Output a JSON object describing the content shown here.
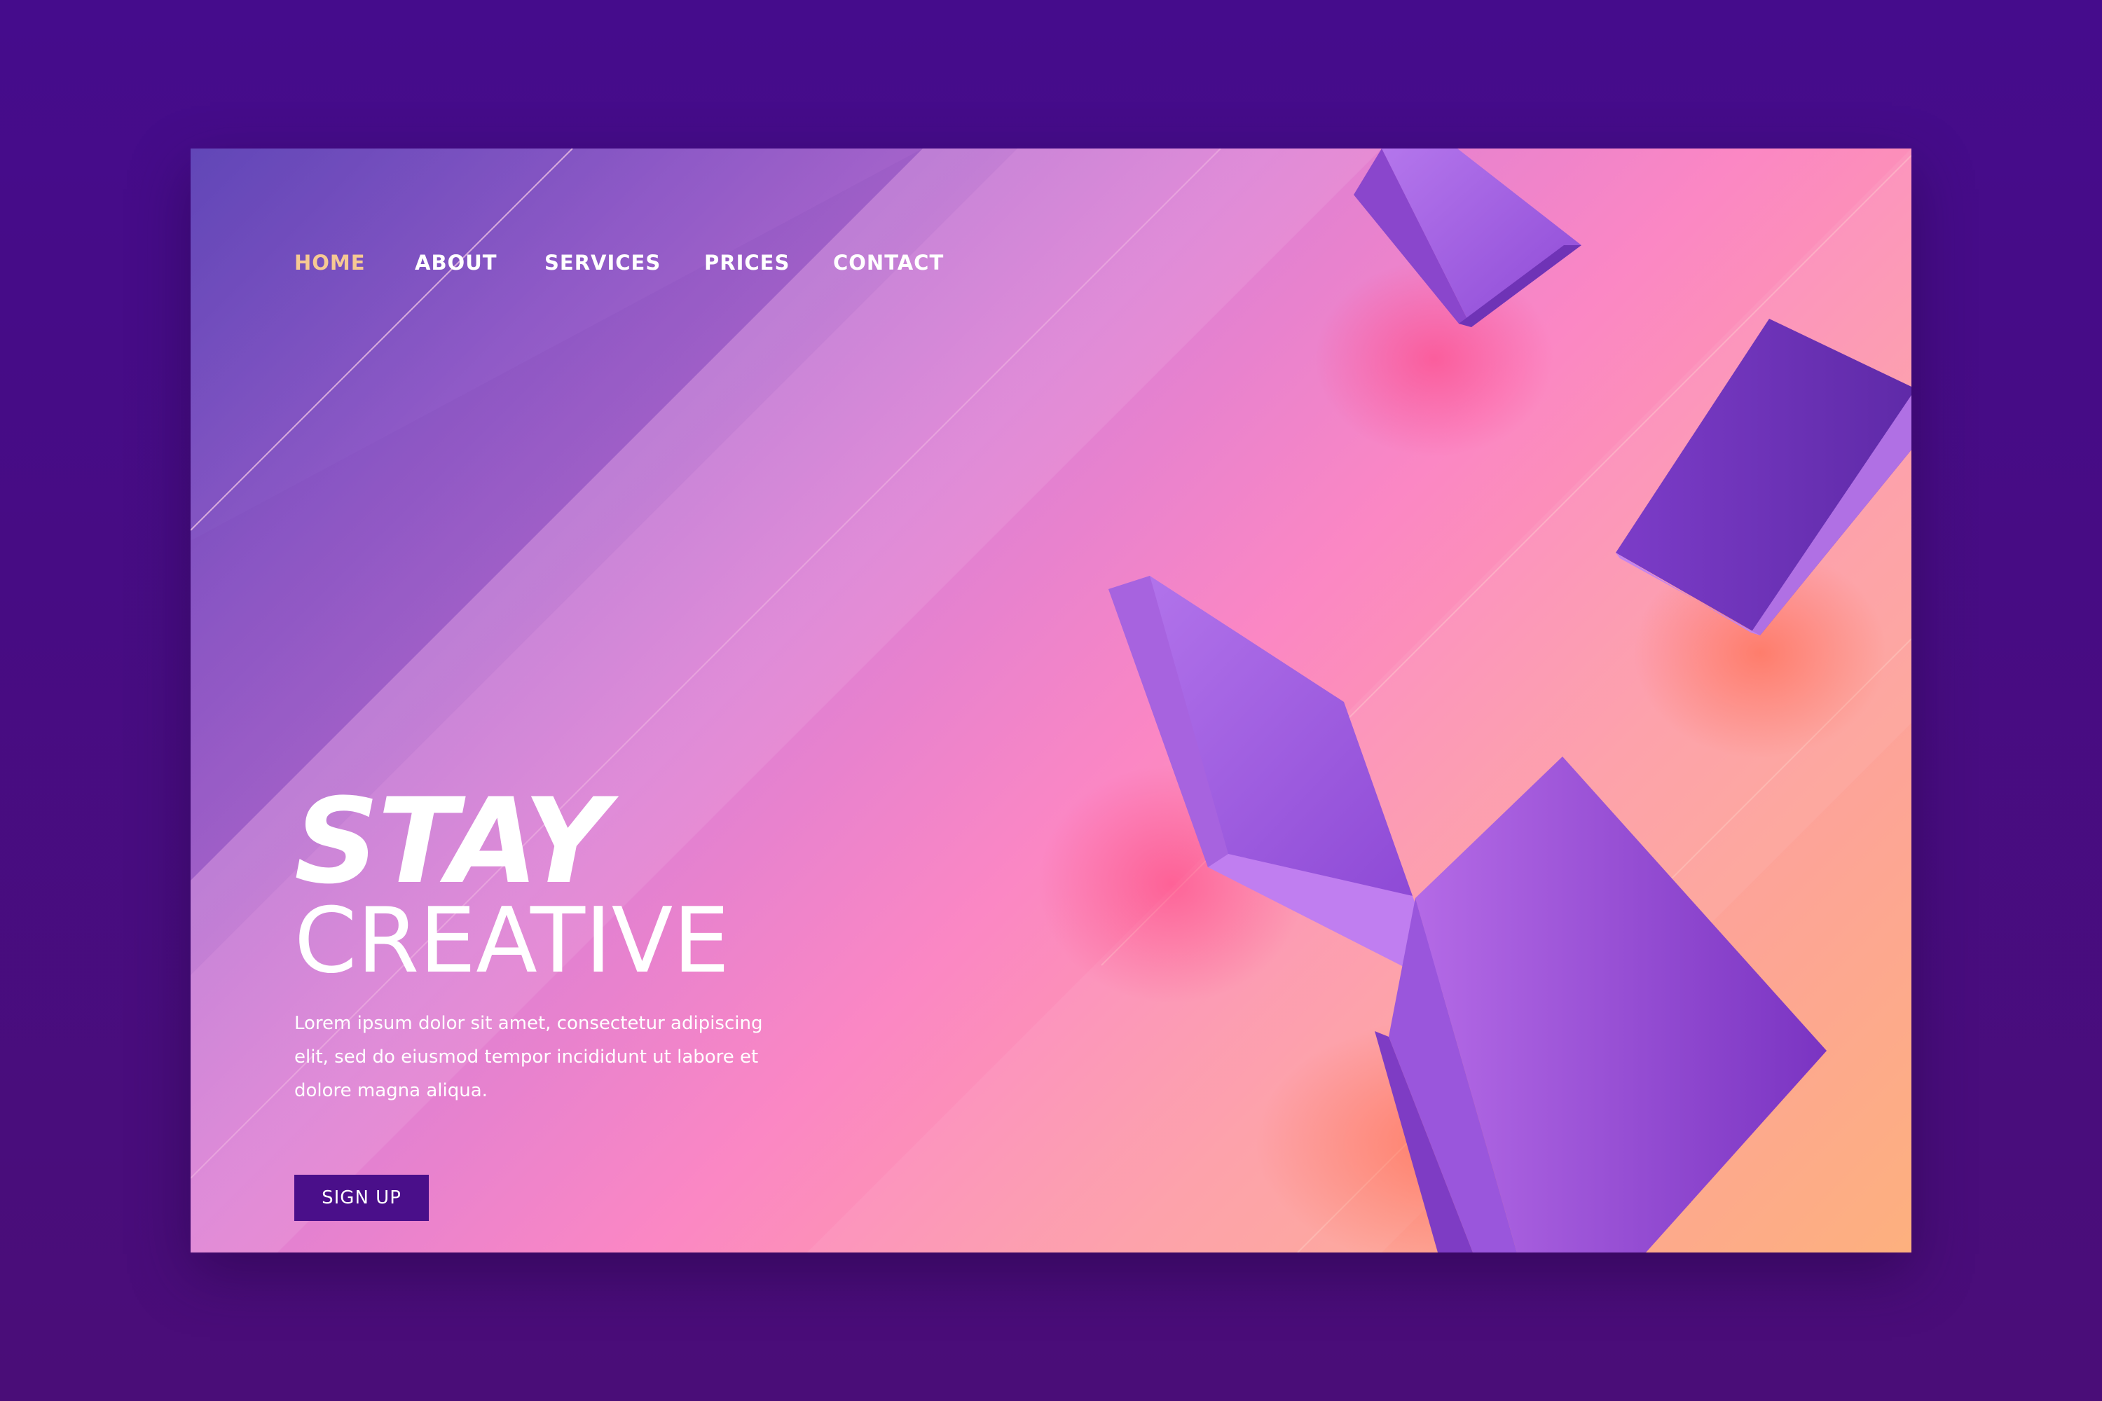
{
  "nav": {
    "items": [
      {
        "label": "HOME",
        "active": true
      },
      {
        "label": "ABOUT",
        "active": false
      },
      {
        "label": "SERVICES",
        "active": false
      },
      {
        "label": "PRICES",
        "active": false
      },
      {
        "label": "CONTACT",
        "active": false
      }
    ]
  },
  "hero": {
    "title_line1": "STAY",
    "title_line2": "CREATIVE",
    "description": "Lorem ipsum dolor sit amet, consectetur adipiscing elit, sed do eiusmod tempor incididunt ut labore et dolore magna aliqua.",
    "cta_label": "SIGN UP"
  },
  "colors": {
    "frame_background": "#450c8c",
    "active_nav": "#f6c993",
    "nav_text": "#ffffff",
    "button_background": "#4a0f8a",
    "cube_purple": "#9a56dc",
    "gradient_start": "#6a4fc0",
    "gradient_end": "#fdb07e"
  }
}
